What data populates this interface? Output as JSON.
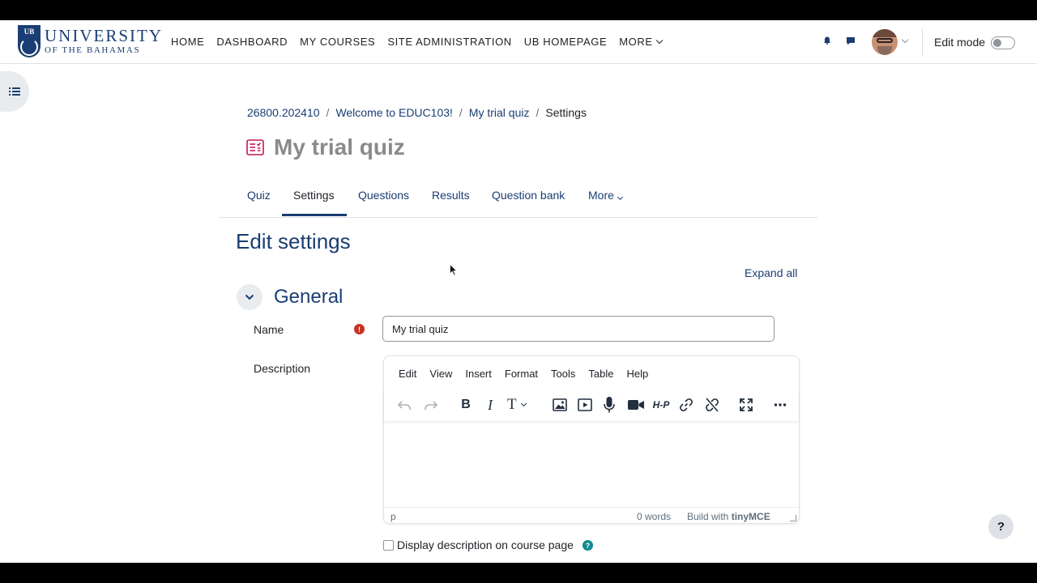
{
  "logo": {
    "badge": "UB",
    "line1": "UNIVERSITY",
    "line2": "OF THE BAHAMAS"
  },
  "nav": {
    "items": [
      "HOME",
      "DASHBOARD",
      "MY COURSES",
      "SITE ADMINISTRATION",
      "UB HOMEPAGE"
    ],
    "more": "MORE"
  },
  "header_right": {
    "edit_mode_label": "Edit mode",
    "edit_mode_on": false
  },
  "breadcrumb": [
    "26800.202410",
    "Welcome to EDUC103!",
    "My trial quiz",
    "Settings"
  ],
  "page_title": "My trial quiz",
  "tabs": {
    "items": [
      "Quiz",
      "Settings",
      "Questions",
      "Results",
      "Question bank"
    ],
    "more": "More",
    "active": "Settings"
  },
  "form": {
    "heading": "Edit settings",
    "expand_all": "Expand all",
    "section_title": "General",
    "name_label": "Name",
    "name_required_icon": "!",
    "name_value": "My trial quiz",
    "description_label": "Description",
    "display_description_label": "Display description on course page",
    "display_description_checked": false
  },
  "editor": {
    "menu": [
      "Edit",
      "View",
      "Insert",
      "Format",
      "Tools",
      "Table",
      "Help"
    ],
    "toolbar_icons": [
      "undo-icon",
      "redo-icon",
      "bold-icon",
      "italic-icon",
      "text-size-icon",
      "image-icon",
      "media-icon",
      "microphone-icon",
      "video-camera-icon",
      "h5p-icon",
      "link-icon",
      "unlink-icon",
      "fullscreen-icon",
      "more-icon"
    ],
    "toolbar_text": {
      "bold": "B",
      "italic": "I",
      "text_size": "T",
      "h5p": "H-P"
    },
    "status_path": "p",
    "word_count": "0 words",
    "build_with": "Build with",
    "brand": "tinyMCE"
  },
  "help_button": "?",
  "help_dot": "?",
  "colors": {
    "brand": "#1a3e73",
    "required": "#ca3120",
    "help": "#0f8b8d",
    "quiz_icon": "#c2185b"
  }
}
